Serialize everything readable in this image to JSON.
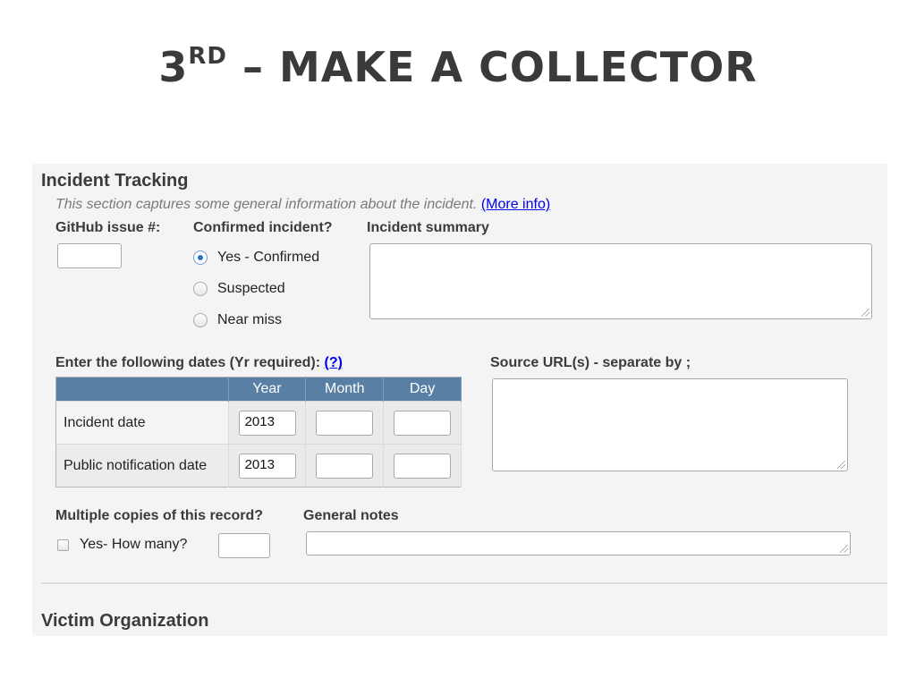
{
  "slide": {
    "title_prefix": "3",
    "title_sup": "RD",
    "title_rest": " – MAKE A COLLECTOR"
  },
  "section1": {
    "title": "Incident Tracking",
    "intro": "This section captures some general information about the incident.",
    "more_info": "(More info)"
  },
  "github": {
    "label": "GitHub issue #:",
    "value": ""
  },
  "confirmed": {
    "label": "Confirmed incident?",
    "options": [
      "Yes - Confirmed",
      "Suspected",
      "Near miss"
    ],
    "selected": "Yes - Confirmed"
  },
  "summary": {
    "label": "Incident summary",
    "value": ""
  },
  "dates": {
    "label": "Enter the following dates (Yr required):",
    "help_link": "(?)",
    "columns": [
      "",
      "Year",
      "Month",
      "Day"
    ],
    "rows": [
      {
        "label": "Incident date",
        "year": "2013",
        "month": "",
        "day": ""
      },
      {
        "label": "Public notification date",
        "year": "2013",
        "month": "",
        "day": ""
      }
    ]
  },
  "source": {
    "label": "Source URL(s) - separate by ;",
    "value": ""
  },
  "copies": {
    "label": "Multiple copies of this record?",
    "checkbox_label": "Yes- How many?",
    "checked": false,
    "value": ""
  },
  "notes": {
    "label": "General notes",
    "value": ""
  },
  "section2": {
    "title": "Victim Organization"
  }
}
